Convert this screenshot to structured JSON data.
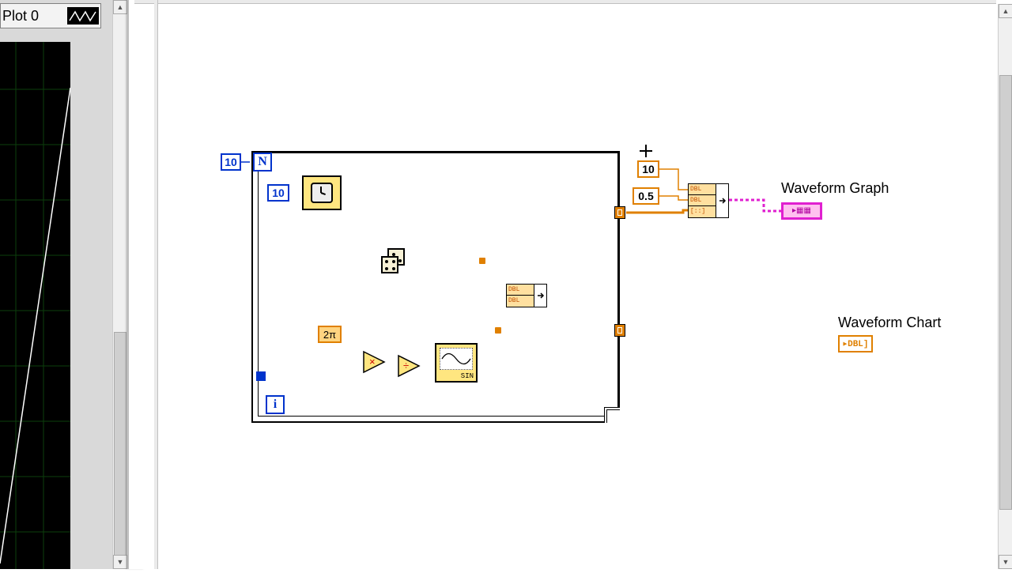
{
  "front_panel": {
    "legend_label": "Plot 0"
  },
  "diagram": {
    "for_loop": {
      "n_glyph": "N",
      "i_glyph": "i",
      "count_const": "10",
      "wait_const": "10",
      "two_pi": "2π",
      "sine_label": "SIN"
    },
    "build_wfm": {
      "const_10": "10",
      "const_0_5": "0.5",
      "row1": "DBL",
      "row2": "DBL",
      "row3": "[::]"
    },
    "build_arr": {
      "row1": "DBL",
      "row2": "DBL"
    },
    "graph": {
      "label": "Waveform Graph",
      "glyph": "▸▦▦"
    },
    "chart": {
      "label": "Waveform Chart",
      "glyph": "▸DBL]"
    }
  }
}
